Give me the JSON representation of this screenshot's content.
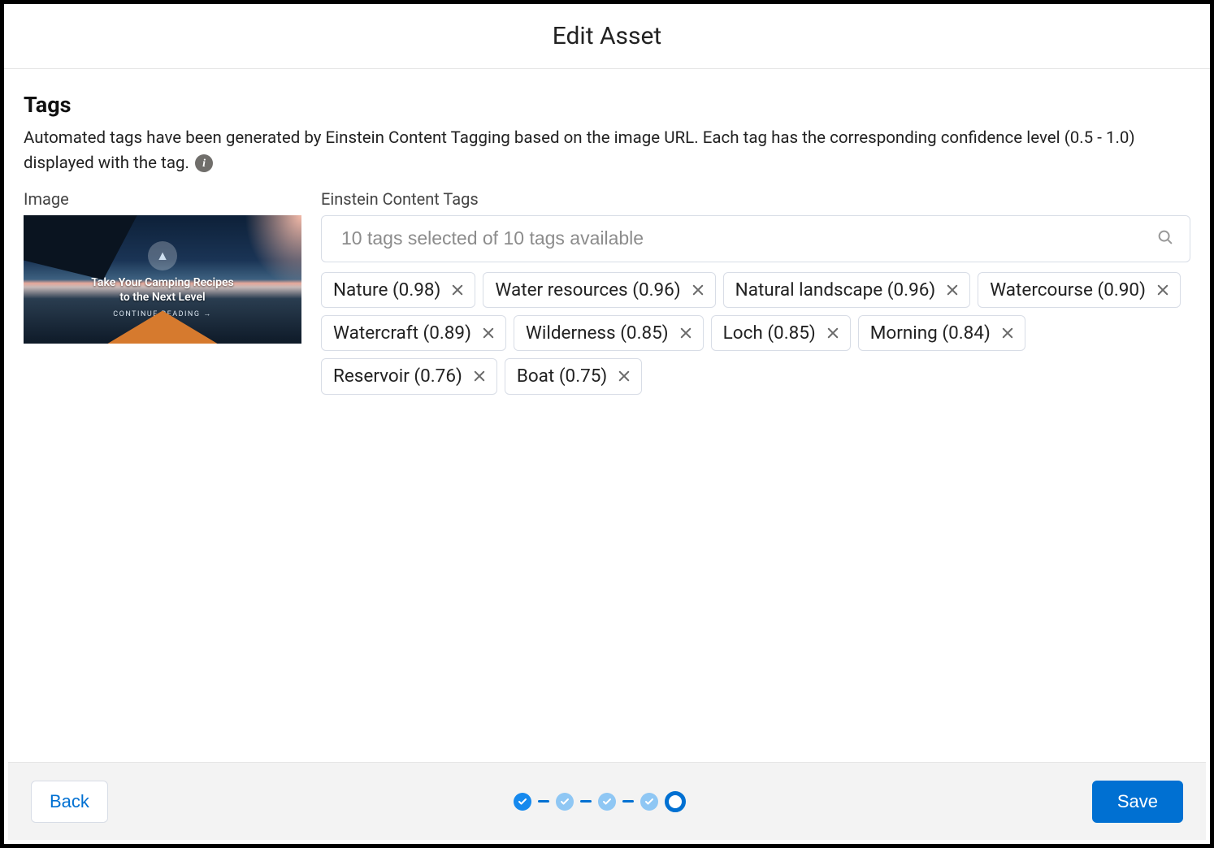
{
  "header": {
    "title": "Edit Asset"
  },
  "section": {
    "title": "Tags",
    "description": "Automated tags have been generated by Einstein Content Tagging based on the image URL. Each tag has the corresponding confidence level (0.5 - 1.0) displayed with the tag."
  },
  "image": {
    "label": "Image",
    "caption_line1": "Take Your Camping Recipes",
    "caption_line2": "to the Next Level",
    "cta": "CONTINUE READING →"
  },
  "tags_panel": {
    "label": "Einstein Content Tags",
    "placeholder": "10 tags selected of 10 tags available",
    "tags": [
      {
        "label": "Nature",
        "confidence": "0.98"
      },
      {
        "label": "Water resources",
        "confidence": "0.96"
      },
      {
        "label": "Natural landscape",
        "confidence": "0.96"
      },
      {
        "label": "Watercourse",
        "confidence": "0.90"
      },
      {
        "label": "Watercraft",
        "confidence": "0.89"
      },
      {
        "label": "Wilderness",
        "confidence": "0.85"
      },
      {
        "label": "Loch",
        "confidence": "0.85"
      },
      {
        "label": "Morning",
        "confidence": "0.84"
      },
      {
        "label": "Reservoir",
        "confidence": "0.76"
      },
      {
        "label": "Boat",
        "confidence": "0.75"
      }
    ]
  },
  "footer": {
    "back": "Back",
    "save": "Save",
    "steps": {
      "completed": 4,
      "current_is_last": true
    }
  }
}
